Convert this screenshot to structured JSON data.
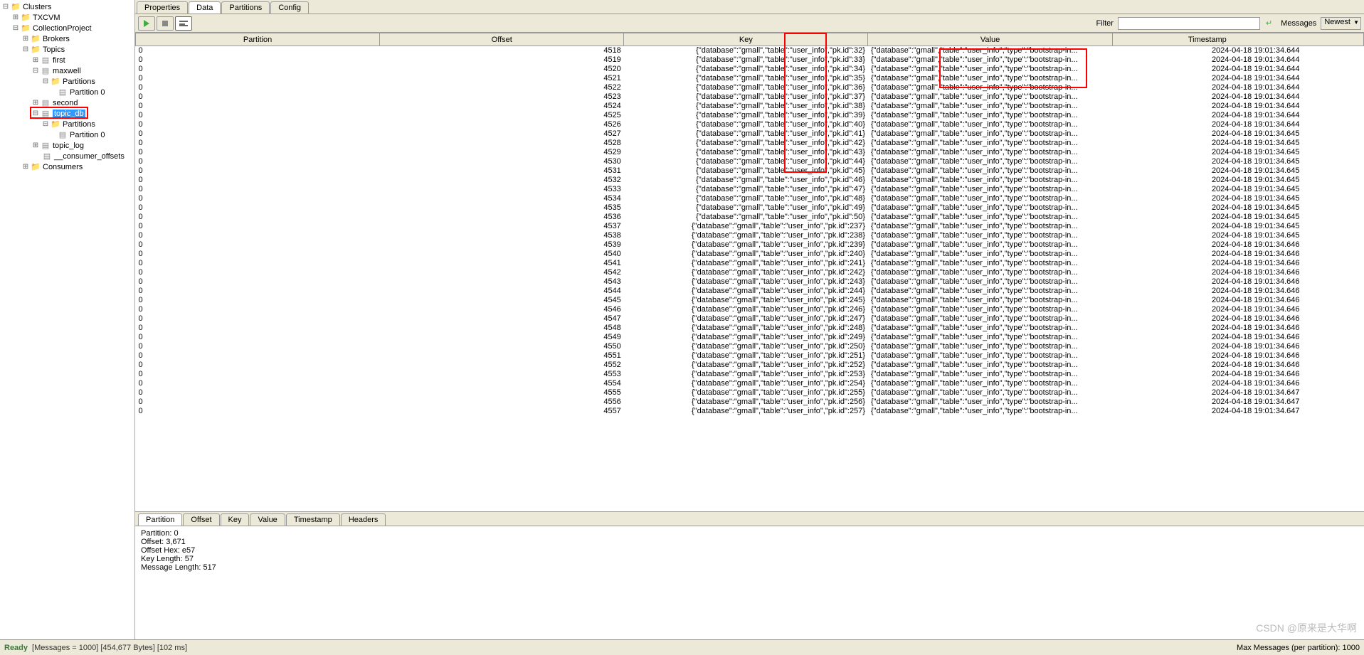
{
  "sidebar": {
    "root": "Clusters",
    "txcvm": "TXCVM",
    "project": "CollectionProject",
    "brokers": "Brokers",
    "topics": "Topics",
    "first": "first",
    "maxwell": "maxwell",
    "partitions": "Partitions",
    "partition0": "Partition 0",
    "second": "second",
    "topic_db": "topic_db",
    "topic_log": "topic_log",
    "consumer_offsets": "__consumer_offsets",
    "consumers": "Consumers"
  },
  "tabs_top": [
    "Properties",
    "Data",
    "Partitions",
    "Config"
  ],
  "active_tab_top": 1,
  "toolbar": {
    "filter_label": "Filter",
    "filter_value": "",
    "messages_label": "Messages",
    "newest": "Newest"
  },
  "columns": [
    "Partition",
    "Offset",
    "Key",
    "Value",
    "Timestamp"
  ],
  "rows": [
    {
      "p": "0",
      "o": "4518",
      "k": "{\"database\":\"gmall\",\"table\":\"user_info\",\"pk.id\":32}",
      "v": "{\"database\":\"gmall\",\"table\":\"user_info\",\"type\":\"bootstrap-in...",
      "t": "2024-04-18 19:01:34.644"
    },
    {
      "p": "0",
      "o": "4519",
      "k": "{\"database\":\"gmall\",\"table\":\"user_info\",\"pk.id\":33}",
      "v": "{\"database\":\"gmall\",\"table\":\"user_info\",\"type\":\"bootstrap-in...",
      "t": "2024-04-18 19:01:34.644"
    },
    {
      "p": "0",
      "o": "4520",
      "k": "{\"database\":\"gmall\",\"table\":\"user_info\",\"pk.id\":34}",
      "v": "{\"database\":\"gmall\",\"table\":\"user_info\",\"type\":\"bootstrap-in...",
      "t": "2024-04-18 19:01:34.644"
    },
    {
      "p": "0",
      "o": "4521",
      "k": "{\"database\":\"gmall\",\"table\":\"user_info\",\"pk.id\":35}",
      "v": "{\"database\":\"gmall\",\"table\":\"user_info\",\"type\":\"bootstrap-in...",
      "t": "2024-04-18 19:01:34.644"
    },
    {
      "p": "0",
      "o": "4522",
      "k": "{\"database\":\"gmall\",\"table\":\"user_info\",\"pk.id\":36}",
      "v": "{\"database\":\"gmall\",\"table\":\"user_info\",\"type\":\"bootstrap-in...",
      "t": "2024-04-18 19:01:34.644"
    },
    {
      "p": "0",
      "o": "4523",
      "k": "{\"database\":\"gmall\",\"table\":\"user_info\",\"pk.id\":37}",
      "v": "{\"database\":\"gmall\",\"table\":\"user_info\",\"type\":\"bootstrap-in...",
      "t": "2024-04-18 19:01:34.644"
    },
    {
      "p": "0",
      "o": "4524",
      "k": "{\"database\":\"gmall\",\"table\":\"user_info\",\"pk.id\":38}",
      "v": "{\"database\":\"gmall\",\"table\":\"user_info\",\"type\":\"bootstrap-in...",
      "t": "2024-04-18 19:01:34.644"
    },
    {
      "p": "0",
      "o": "4525",
      "k": "{\"database\":\"gmall\",\"table\":\"user_info\",\"pk.id\":39}",
      "v": "{\"database\":\"gmall\",\"table\":\"user_info\",\"type\":\"bootstrap-in...",
      "t": "2024-04-18 19:01:34.644"
    },
    {
      "p": "0",
      "o": "4526",
      "k": "{\"database\":\"gmall\",\"table\":\"user_info\",\"pk.id\":40}",
      "v": "{\"database\":\"gmall\",\"table\":\"user_info\",\"type\":\"bootstrap-in...",
      "t": "2024-04-18 19:01:34.644"
    },
    {
      "p": "0",
      "o": "4527",
      "k": "{\"database\":\"gmall\",\"table\":\"user_info\",\"pk.id\":41}",
      "v": "{\"database\":\"gmall\",\"table\":\"user_info\",\"type\":\"bootstrap-in...",
      "t": "2024-04-18 19:01:34.645"
    },
    {
      "p": "0",
      "o": "4528",
      "k": "{\"database\":\"gmall\",\"table\":\"user_info\",\"pk.id\":42}",
      "v": "{\"database\":\"gmall\",\"table\":\"user_info\",\"type\":\"bootstrap-in...",
      "t": "2024-04-18 19:01:34.645"
    },
    {
      "p": "0",
      "o": "4529",
      "k": "{\"database\":\"gmall\",\"table\":\"user_info\",\"pk.id\":43}",
      "v": "{\"database\":\"gmall\",\"table\":\"user_info\",\"type\":\"bootstrap-in...",
      "t": "2024-04-18 19:01:34.645"
    },
    {
      "p": "0",
      "o": "4530",
      "k": "{\"database\":\"gmall\",\"table\":\"user_info\",\"pk.id\":44}",
      "v": "{\"database\":\"gmall\",\"table\":\"user_info\",\"type\":\"bootstrap-in...",
      "t": "2024-04-18 19:01:34.645"
    },
    {
      "p": "0",
      "o": "4531",
      "k": "{\"database\":\"gmall\",\"table\":\"user_info\",\"pk.id\":45}",
      "v": "{\"database\":\"gmall\",\"table\":\"user_info\",\"type\":\"bootstrap-in...",
      "t": "2024-04-18 19:01:34.645"
    },
    {
      "p": "0",
      "o": "4532",
      "k": "{\"database\":\"gmall\",\"table\":\"user_info\",\"pk.id\":46}",
      "v": "{\"database\":\"gmall\",\"table\":\"user_info\",\"type\":\"bootstrap-in...",
      "t": "2024-04-18 19:01:34.645"
    },
    {
      "p": "0",
      "o": "4533",
      "k": "{\"database\":\"gmall\",\"table\":\"user_info\",\"pk.id\":47}",
      "v": "{\"database\":\"gmall\",\"table\":\"user_info\",\"type\":\"bootstrap-in...",
      "t": "2024-04-18 19:01:34.645"
    },
    {
      "p": "0",
      "o": "4534",
      "k": "{\"database\":\"gmall\",\"table\":\"user_info\",\"pk.id\":48}",
      "v": "{\"database\":\"gmall\",\"table\":\"user_info\",\"type\":\"bootstrap-in...",
      "t": "2024-04-18 19:01:34.645"
    },
    {
      "p": "0",
      "o": "4535",
      "k": "{\"database\":\"gmall\",\"table\":\"user_info\",\"pk.id\":49}",
      "v": "{\"database\":\"gmall\",\"table\":\"user_info\",\"type\":\"bootstrap-in...",
      "t": "2024-04-18 19:01:34.645"
    },
    {
      "p": "0",
      "o": "4536",
      "k": "{\"database\":\"gmall\",\"table\":\"user_info\",\"pk.id\":50}",
      "v": "{\"database\":\"gmall\",\"table\":\"user_info\",\"type\":\"bootstrap-in...",
      "t": "2024-04-18 19:01:34.645"
    },
    {
      "p": "0",
      "o": "4537",
      "k": "{\"database\":\"gmall\",\"table\":\"user_info\",\"pk.id\":237}",
      "v": "{\"database\":\"gmall\",\"table\":\"user_info\",\"type\":\"bootstrap-in...",
      "t": "2024-04-18 19:01:34.645"
    },
    {
      "p": "0",
      "o": "4538",
      "k": "{\"database\":\"gmall\",\"table\":\"user_info\",\"pk.id\":238}",
      "v": "{\"database\":\"gmall\",\"table\":\"user_info\",\"type\":\"bootstrap-in...",
      "t": "2024-04-18 19:01:34.645"
    },
    {
      "p": "0",
      "o": "4539",
      "k": "{\"database\":\"gmall\",\"table\":\"user_info\",\"pk.id\":239}",
      "v": "{\"database\":\"gmall\",\"table\":\"user_info\",\"type\":\"bootstrap-in...",
      "t": "2024-04-18 19:01:34.646"
    },
    {
      "p": "0",
      "o": "4540",
      "k": "{\"database\":\"gmall\",\"table\":\"user_info\",\"pk.id\":240}",
      "v": "{\"database\":\"gmall\",\"table\":\"user_info\",\"type\":\"bootstrap-in...",
      "t": "2024-04-18 19:01:34.646"
    },
    {
      "p": "0",
      "o": "4541",
      "k": "{\"database\":\"gmall\",\"table\":\"user_info\",\"pk.id\":241}",
      "v": "{\"database\":\"gmall\",\"table\":\"user_info\",\"type\":\"bootstrap-in...",
      "t": "2024-04-18 19:01:34.646"
    },
    {
      "p": "0",
      "o": "4542",
      "k": "{\"database\":\"gmall\",\"table\":\"user_info\",\"pk.id\":242}",
      "v": "{\"database\":\"gmall\",\"table\":\"user_info\",\"type\":\"bootstrap-in...",
      "t": "2024-04-18 19:01:34.646"
    },
    {
      "p": "0",
      "o": "4543",
      "k": "{\"database\":\"gmall\",\"table\":\"user_info\",\"pk.id\":243}",
      "v": "{\"database\":\"gmall\",\"table\":\"user_info\",\"type\":\"bootstrap-in...",
      "t": "2024-04-18 19:01:34.646"
    },
    {
      "p": "0",
      "o": "4544",
      "k": "{\"database\":\"gmall\",\"table\":\"user_info\",\"pk.id\":244}",
      "v": "{\"database\":\"gmall\",\"table\":\"user_info\",\"type\":\"bootstrap-in...",
      "t": "2024-04-18 19:01:34.646"
    },
    {
      "p": "0",
      "o": "4545",
      "k": "{\"database\":\"gmall\",\"table\":\"user_info\",\"pk.id\":245}",
      "v": "{\"database\":\"gmall\",\"table\":\"user_info\",\"type\":\"bootstrap-in...",
      "t": "2024-04-18 19:01:34.646"
    },
    {
      "p": "0",
      "o": "4546",
      "k": "{\"database\":\"gmall\",\"table\":\"user_info\",\"pk.id\":246}",
      "v": "{\"database\":\"gmall\",\"table\":\"user_info\",\"type\":\"bootstrap-in...",
      "t": "2024-04-18 19:01:34.646"
    },
    {
      "p": "0",
      "o": "4547",
      "k": "{\"database\":\"gmall\",\"table\":\"user_info\",\"pk.id\":247}",
      "v": "{\"database\":\"gmall\",\"table\":\"user_info\",\"type\":\"bootstrap-in...",
      "t": "2024-04-18 19:01:34.646"
    },
    {
      "p": "0",
      "o": "4548",
      "k": "{\"database\":\"gmall\",\"table\":\"user_info\",\"pk.id\":248}",
      "v": "{\"database\":\"gmall\",\"table\":\"user_info\",\"type\":\"bootstrap-in...",
      "t": "2024-04-18 19:01:34.646"
    },
    {
      "p": "0",
      "o": "4549",
      "k": "{\"database\":\"gmall\",\"table\":\"user_info\",\"pk.id\":249}",
      "v": "{\"database\":\"gmall\",\"table\":\"user_info\",\"type\":\"bootstrap-in...",
      "t": "2024-04-18 19:01:34.646"
    },
    {
      "p": "0",
      "o": "4550",
      "k": "{\"database\":\"gmall\",\"table\":\"user_info\",\"pk.id\":250}",
      "v": "{\"database\":\"gmall\",\"table\":\"user_info\",\"type\":\"bootstrap-in...",
      "t": "2024-04-18 19:01:34.646"
    },
    {
      "p": "0",
      "o": "4551",
      "k": "{\"database\":\"gmall\",\"table\":\"user_info\",\"pk.id\":251}",
      "v": "{\"database\":\"gmall\",\"table\":\"user_info\",\"type\":\"bootstrap-in...",
      "t": "2024-04-18 19:01:34.646"
    },
    {
      "p": "0",
      "o": "4552",
      "k": "{\"database\":\"gmall\",\"table\":\"user_info\",\"pk.id\":252}",
      "v": "{\"database\":\"gmall\",\"table\":\"user_info\",\"type\":\"bootstrap-in...",
      "t": "2024-04-18 19:01:34.646"
    },
    {
      "p": "0",
      "o": "4553",
      "k": "{\"database\":\"gmall\",\"table\":\"user_info\",\"pk.id\":253}",
      "v": "{\"database\":\"gmall\",\"table\":\"user_info\",\"type\":\"bootstrap-in...",
      "t": "2024-04-18 19:01:34.646"
    },
    {
      "p": "0",
      "o": "4554",
      "k": "{\"database\":\"gmall\",\"table\":\"user_info\",\"pk.id\":254}",
      "v": "{\"database\":\"gmall\",\"table\":\"user_info\",\"type\":\"bootstrap-in...",
      "t": "2024-04-18 19:01:34.646"
    },
    {
      "p": "0",
      "o": "4555",
      "k": "{\"database\":\"gmall\",\"table\":\"user_info\",\"pk.id\":255}",
      "v": "{\"database\":\"gmall\",\"table\":\"user_info\",\"type\":\"bootstrap-in...",
      "t": "2024-04-18 19:01:34.647"
    },
    {
      "p": "0",
      "o": "4556",
      "k": "{\"database\":\"gmall\",\"table\":\"user_info\",\"pk.id\":256}",
      "v": "{\"database\":\"gmall\",\"table\":\"user_info\",\"type\":\"bootstrap-in...",
      "t": "2024-04-18 19:01:34.647"
    },
    {
      "p": "0",
      "o": "4557",
      "k": "{\"database\":\"gmall\",\"table\":\"user_info\",\"pk.id\":257}",
      "v": "{\"database\":\"gmall\",\"table\":\"user_info\",\"type\":\"bootstrap-in...",
      "t": "2024-04-18 19:01:34.647"
    }
  ],
  "detail_tabs": [
    "Partition",
    "Offset",
    "Key",
    "Value",
    "Timestamp",
    "Headers"
  ],
  "detail": {
    "l1": "Partition: 0",
    "l2": "Offset: 3,671",
    "l3": "Offset Hex: e57",
    "l4": "Key Length: 57",
    "l5": "Message Length: 517"
  },
  "status": {
    "ready": "Ready",
    "info": "[Messages = 1000]  [454,677 Bytes]  [102 ms]",
    "right": "Max Messages (per partition):   1000"
  },
  "watermark": "CSDN @原来是大华啊"
}
